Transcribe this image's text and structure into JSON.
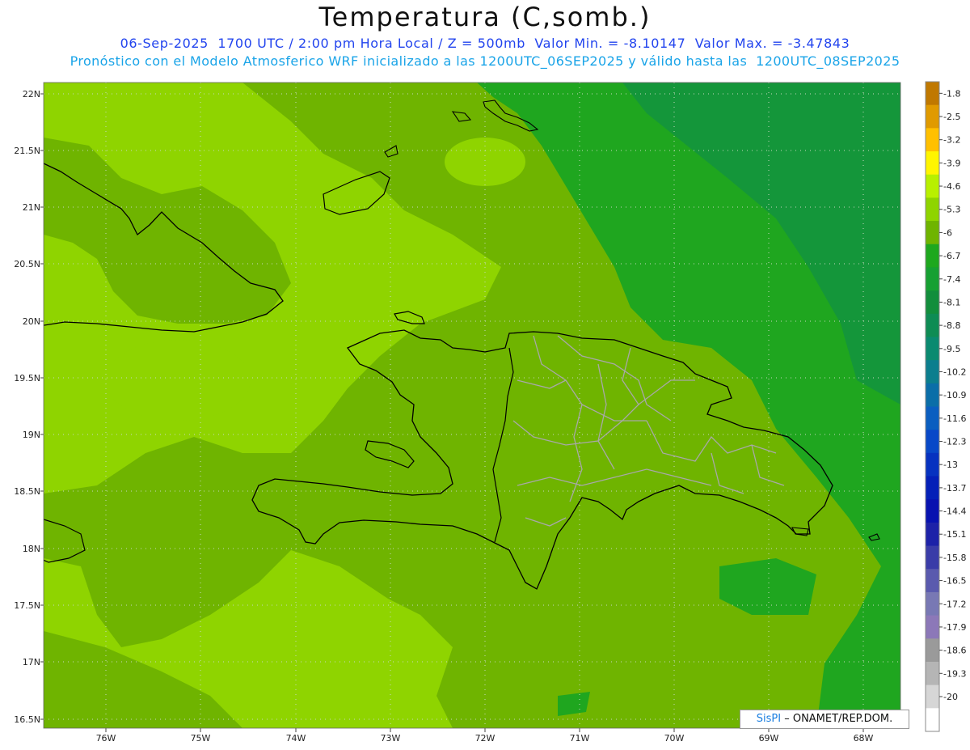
{
  "header": {
    "title": "Temperatura (C,somb.)",
    "line1": "06-Sep-2025  1700 UTC / 2:00 pm Hora Local / Z = 500mb  Valor Min. = -8.10147  Valor Max. = -3.47843",
    "line2": "Pronóstico con el Modelo Atmosferico WRF inicializado a las 1200UTC_06SEP2025 y válido hasta las  1200UTC_08SEP2025"
  },
  "axes": {
    "lat_labels": [
      "22N",
      "21.5N",
      "21N",
      "20.5N",
      "20N",
      "19.5N",
      "19N",
      "18.5N",
      "18N",
      "17.5N",
      "17N",
      "16.5N"
    ],
    "lon_labels": [
      "76W",
      "75W",
      "74W",
      "73W",
      "72W",
      "71W",
      "70W",
      "69W",
      "68W"
    ]
  },
  "colorbar": {
    "labels": [
      "-1.8",
      "-2.5",
      "-3.2",
      "-3.9",
      "-4.6",
      "-5.3",
      "-6",
      "-6.7",
      "-7.4",
      "-8.1",
      "-8.8",
      "-9.5",
      "-10.2",
      "-10.9",
      "-11.6",
      "-12.3",
      "-13",
      "-13.7",
      "-14.4",
      "-15.1",
      "-15.8",
      "-16.5",
      "-17.2",
      "-17.9",
      "-18.6",
      "-19.3",
      "-20"
    ],
    "colors": [
      "#c07800",
      "#e09a00",
      "#ffc000",
      "#fff500",
      "#b8f000",
      "#8fd400",
      "#6fb400",
      "#1ea81e",
      "#16a032",
      "#128e3c",
      "#0e8c54",
      "#0a8a70",
      "#0b7e8e",
      "#0a6ea8",
      "#0a5ec0",
      "#0848c8",
      "#0632c0",
      "#0420b8",
      "#0812b0",
      "#1d22a8",
      "#3a3ca8",
      "#5a5aae",
      "#7878b4",
      "#8c78b8",
      "#9a9a9a",
      "#b5b5b5",
      "#d6d6d6",
      "#ffffff"
    ]
  },
  "map_colors": {
    "light": "#8fd400",
    "mid": "#6fb400",
    "green": "#1fa61f",
    "dark": "#14963a"
  },
  "credit": {
    "brand": "SisPI",
    "rest": "– ONAMET/REP.DOM."
  }
}
